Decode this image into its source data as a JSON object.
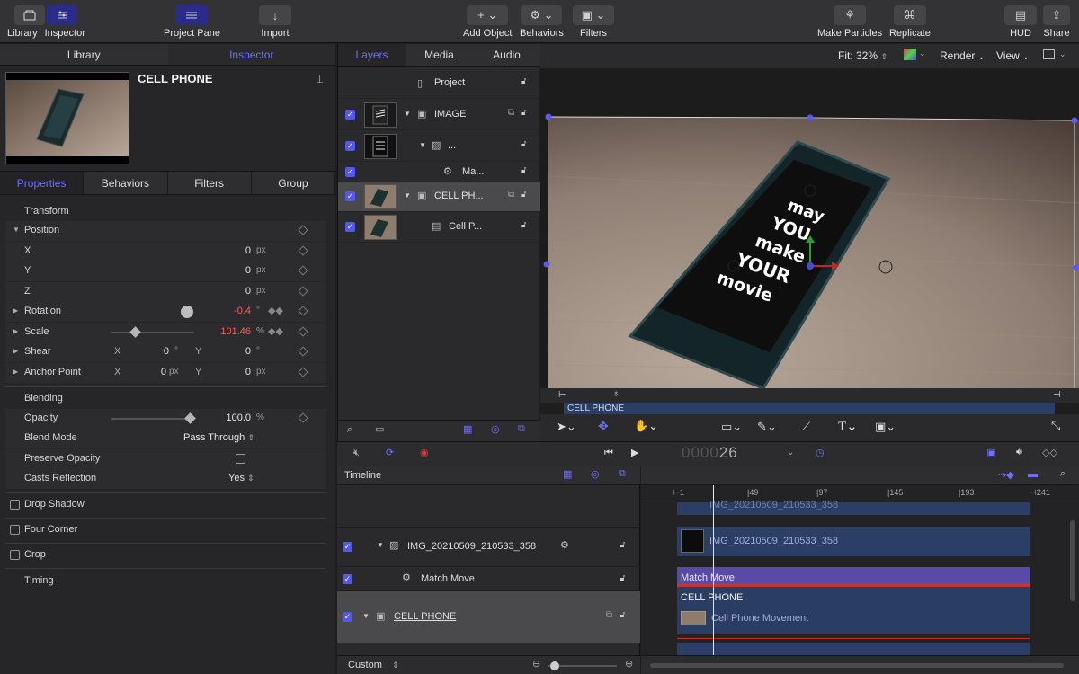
{
  "toolbar": {
    "library": "Library",
    "inspector": "Inspector",
    "project_pane": "Project Pane",
    "import": "Import",
    "add_object": "Add Object",
    "behaviors": "Behaviors",
    "filters": "Filters",
    "make_particles": "Make Particles",
    "replicate": "Replicate",
    "hud": "HUD",
    "share": "Share"
  },
  "inspector": {
    "tab_library": "Library",
    "tab_inspector": "Inspector",
    "title": "CELL PHONE",
    "tabs": [
      "Properties",
      "Behaviors",
      "Filters",
      "Group"
    ],
    "transform": "Transform",
    "position": "Position",
    "x": {
      "label": "X",
      "value": "0",
      "unit": "px"
    },
    "y": {
      "label": "Y",
      "value": "0",
      "unit": "px"
    },
    "z": {
      "label": "Z",
      "value": "0",
      "unit": "px"
    },
    "rotation": {
      "label": "Rotation",
      "value": "-0.4",
      "unit": "°"
    },
    "scale": {
      "label": "Scale",
      "value": "101.46",
      "unit": "%"
    },
    "shear": {
      "label": "Shear",
      "xlabel": "X",
      "xval": "0",
      "xunit": "°",
      "ylabel": "Y",
      "yval": "0",
      "yunit": "°"
    },
    "anchor": {
      "label": "Anchor Point",
      "xlabel": "X",
      "xval": "0",
      "xunit": "px",
      "ylabel": "Y",
      "yval": "0",
      "yunit": "px"
    },
    "blending": "Blending",
    "opacity": {
      "label": "Opacity",
      "value": "100.0",
      "unit": "%"
    },
    "blend_mode": {
      "label": "Blend Mode",
      "value": "Pass Through"
    },
    "preserve_opacity": "Preserve Opacity",
    "casts_reflection": {
      "label": "Casts Reflection",
      "value": "Yes"
    },
    "drop_shadow": "Drop Shadow",
    "four_corner": "Four Corner",
    "crop": "Crop",
    "timing": "Timing"
  },
  "layers": {
    "tabs": [
      "Layers",
      "Media",
      "Audio"
    ],
    "project": "Project",
    "rows": [
      "IMAGE",
      "...",
      "Ma...",
      "CELL PH...",
      "Cell P..."
    ]
  },
  "canvas": {
    "fit": "Fit: 32%",
    "render": "Render",
    "view": "View",
    "clip_label": "CELL PHONE",
    "screen_words": [
      "may",
      "YOU",
      "make",
      "YOUR",
      "movie"
    ]
  },
  "transport": {
    "timecode_dim": "0000",
    "timecode_frame": "26"
  },
  "timeline": {
    "title": "Timeline",
    "rows": {
      "img": "IMG_20210509_210533_358",
      "match_move": "Match Move",
      "cell_phone": "CELL PHONE"
    },
    "ruler": [
      "1",
      "49",
      "97",
      "145",
      "193",
      "241"
    ],
    "bars": {
      "img": "IMG_20210509_210533_358",
      "img_top": "IMG_20210509_210533_358",
      "match_move": "Match Move",
      "cell_phone": "CELL PHONE",
      "movement": "Cell Phone Movement"
    },
    "footer_preset": "Custom"
  },
  "colors": {
    "accent": "#6f6ff5",
    "selection": "#2b2b8a",
    "red_value": "#ff5a5a",
    "clip_blue": "#2b3f66",
    "behavior_purple": "#5a4aa8"
  }
}
